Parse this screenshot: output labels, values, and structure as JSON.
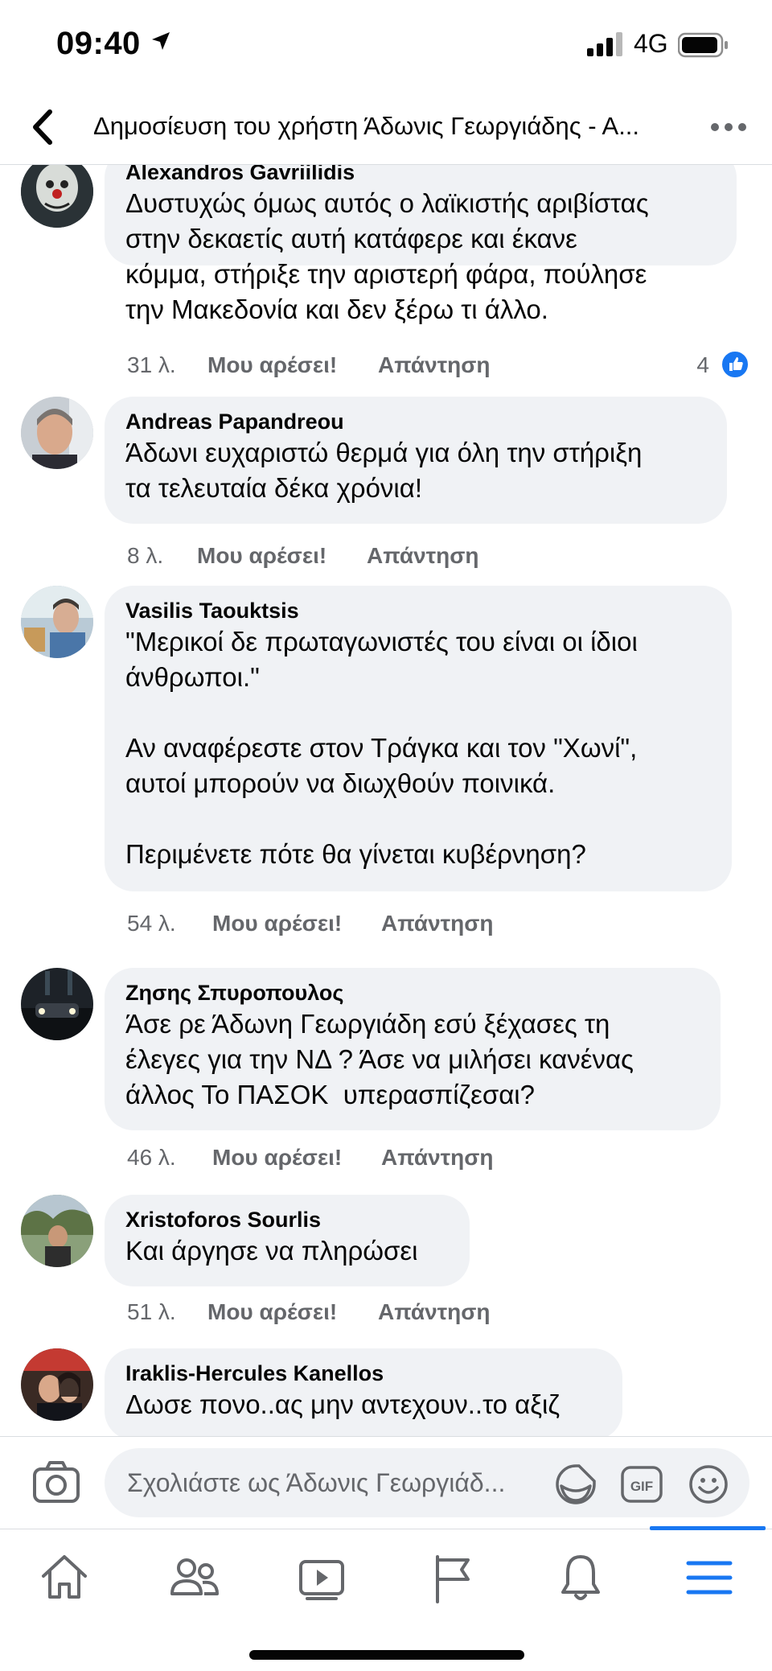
{
  "status_bar": {
    "time": "09:40",
    "network": "4G"
  },
  "header": {
    "title": "Δημοσίευση του χρήστη Άδωνις Γεωργιάδης - Α..."
  },
  "colors": {
    "accent": "#1877f2",
    "bubble": "#f0f2f5",
    "meta_text": "#65676b"
  },
  "comments": [
    {
      "author": "Alexandros Gavriilidis",
      "text": "Δυστυχώς όμως αυτός ο λαϊκιστής αριβίστας\nστην δεκαετίς αυτή κατάφερε και έκανε\nκόμμα, στήριξε την αριστερή φάρα, πούλησε\nτην Μακεδονία και δεν ξέρω τι άλλο.",
      "time": "31 λ.",
      "like": "Μου αρέσει!",
      "reply": "Απάντηση",
      "reactions": "4",
      "reaction_icon": "thumbs-up-icon"
    },
    {
      "author": "Andreas Papandreou",
      "text": "Άδωνι ευχαριστώ θερμά για όλη την στήριξη\nτα τελευταία δέκα χρόνια!",
      "time": "8 λ.",
      "like": "Μου αρέσει!",
      "reply": "Απάντηση"
    },
    {
      "author": "Vasilis Taouktsis",
      "text": "\"Μερικοί δε πρωταγωνιστές του είναι οι ίδιοι\nάνθρωποι.\"\n\nΑν αναφέρεστε στον Τράγκα και τον \"Χωνί\",\nαυτοί μπορούν να διωχθούν ποινικά.\n\nΠεριμένετε πότε θα γίνεται κυβέρνηση?",
      "time": "54 λ.",
      "like": "Μου αρέσει!",
      "reply": "Απάντηση"
    },
    {
      "author": "Ζησης Σπυροπουλος",
      "text": "Άσε ρε Άδωνη Γεωργιάδη εσύ ξέχασες τη\nέλεγες για την ΝΔ ? Άσε να μιλήσει κανένας\nάλλος Το ΠΑΣΟΚ  υπερασπίζεσαι?",
      "time": "46 λ.",
      "like": "Μου αρέσει!",
      "reply": "Απάντηση"
    },
    {
      "author": "Xristoforos Sourlis",
      "text": "Και άργησε να πληρώσει",
      "time": "51 λ.",
      "like": "Μου αρέσει!",
      "reply": "Απάντηση"
    },
    {
      "author": "Iraklis-Hercules Kanellos",
      "text": "Δωσε πονο..ας μην αντεχουν..το αξιζ",
      "time": "",
      "like": "",
      "reply": ""
    }
  ],
  "composer": {
    "placeholder": "Σχολιάστε ως Άδωνις Γεωργιάδ..."
  },
  "tabs": [
    "home-icon",
    "friends-icon",
    "watch-icon",
    "pages-flag-icon",
    "notifications-bell-icon",
    "menu-icon"
  ],
  "active_tab": "menu-icon"
}
